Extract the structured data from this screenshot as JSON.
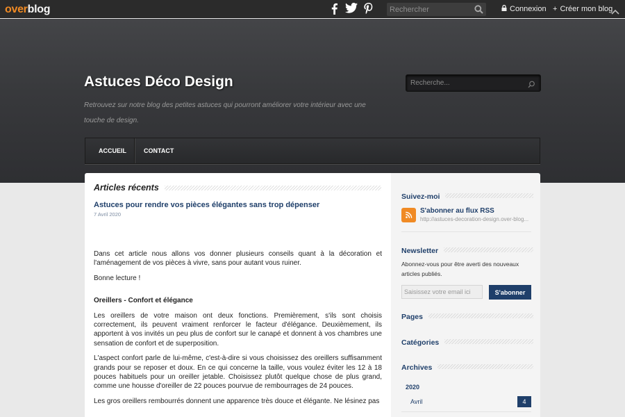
{
  "topbar": {
    "logo_part1": "over",
    "logo_part2": "blog",
    "search_placeholder": "Rechercher",
    "login": "Connexion",
    "create_blog_symbol": "+",
    "create_blog": "Créer mon blog",
    "social_icons": [
      "facebook-icon",
      "twitter-icon",
      "pinterest-icon"
    ]
  },
  "header": {
    "title": "Astuces Déco Design",
    "description": "Retrouvez sur notre blog des petites astuces qui pourront améliorer votre intérieur avec une touche de design.",
    "search_placeholder": "Recherche...",
    "nav": [
      "ACCUEIL",
      "CONTACT"
    ]
  },
  "content": {
    "section_title": "Articles récents",
    "post": {
      "title": "Astuces pour rendre vos pièces élégantes sans trop dépenser",
      "date": "7 Avril 2020",
      "paragraphs": [
        "Dans cet article nous allons vos donner plusieurs conseils quant à la décoration et l'aménagement de vos pièces à vivre, sans pour autant vous ruiner.",
        "Bonne lecture !"
      ],
      "subheading": "Oreillers - Confort et élégance",
      "paragraphs2": [
        "Les oreillers de votre maison ont deux fonctions. Premièrement, s'ils sont choisis correctement, ils peuvent vraiment renforcer le facteur d'élégance. Deuxièmement, ils apportent à vos invités un peu plus de confort sur le canapé et donnent à vos chambres une sensation de confort et de superposition.",
        "L'aspect confort parle de lui-même, c'est-à-dire si vous choisissez des oreillers suffisamment grands pour se reposer et doux. En ce qui concerne la taille, vous voulez éviter les 12 à 18 pouces habituels pour un oreiller jetable. Choisissez plutôt quelque chose de plus grand, comme une housse d'oreiller de 22 pouces pourvue de rembourrages de 24 pouces.",
        "Les gros oreillers rembourrés donnent une apparence très douce et élégante. Ne lésinez pas"
      ]
    }
  },
  "sidebar": {
    "follow_title": "Suivez-moi",
    "rss_title": "S'abonner au flux RSS",
    "rss_url": "http://astuces-decoration-design.over-blog...",
    "newsletter_title": "Newsletter",
    "newsletter_text": "Abonnez-vous pour être averti des nouveaux articles publiés.",
    "email_placeholder": "Saisissez votre email ici",
    "subscribe_label": "S'abonner",
    "pages_title": "Pages",
    "categories_title": "Catégories",
    "archives_title": "Archives",
    "archive_year": "2020",
    "archive_month": "Avril",
    "archive_count": "4"
  },
  "colors": {
    "accent": "#1f3f6a",
    "logo_orange": "#f08a24",
    "topbar": "#2b2b2b"
  }
}
